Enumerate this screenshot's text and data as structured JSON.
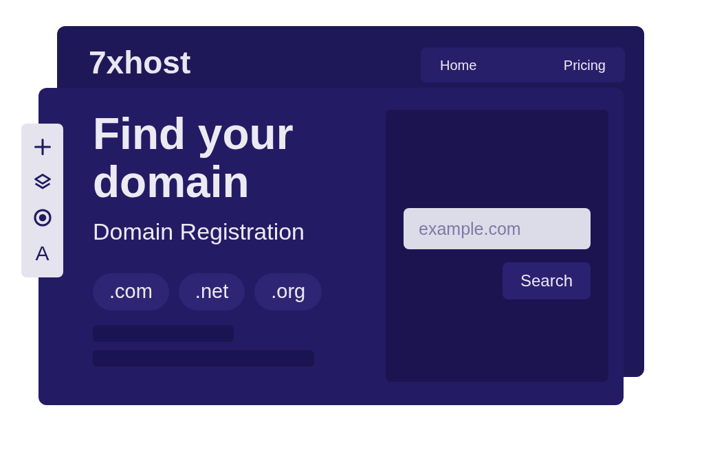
{
  "header": {
    "logo": "7xhost",
    "nav": [
      {
        "label": "Home"
      },
      {
        "label": "Pricing"
      }
    ]
  },
  "hero": {
    "title": "Find your domain",
    "subtitle": "Domain Registration",
    "tlds": [
      ".com",
      ".net",
      ".org"
    ]
  },
  "search": {
    "placeholder": "example.com",
    "button": "Search"
  },
  "toolbar": [
    {
      "kind": "plus"
    },
    {
      "kind": "layers"
    },
    {
      "kind": "target"
    },
    {
      "kind": "text",
      "label": "A"
    }
  ]
}
